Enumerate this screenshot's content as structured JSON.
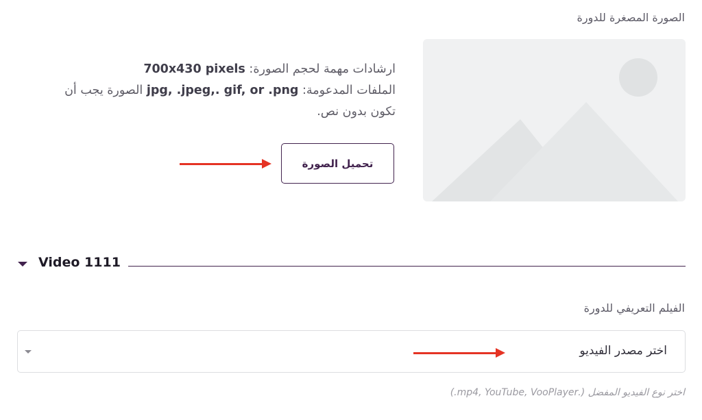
{
  "thumbnail": {
    "title": "الصورة المصغرة للدورة",
    "guidelines": {
      "line1_text": "ارشادات مهمة لحجم الصورة: ",
      "line1_bold": "700x430 pixels",
      "line2_text1": "الملفات المدعومة: ",
      "line2_bold": "jpg, .jpeg,. gif, or .png",
      "line2_text2": " الصورة يجب أن",
      "line3_text": "تكون بدون نص."
    },
    "upload_label": "تحميل الصورة"
  },
  "video_section": {
    "title": "Video 1111",
    "field_label": "الفيلم التعريفي للدورة",
    "select_value": "اختر مصدر الفيديو",
    "hint": "اختر نوع الفيديو المفضل (.mp4, YouTube, VooPlayer.)"
  },
  "colors": {
    "accent": "#41224d",
    "annotation_arrow": "#e53324",
    "placeholder_bg": "#f0f1f2"
  },
  "icons": [
    "image-placeholder-icon",
    "caret-down-icon",
    "select-chevron-icon",
    "annotation-arrow-icon"
  ]
}
